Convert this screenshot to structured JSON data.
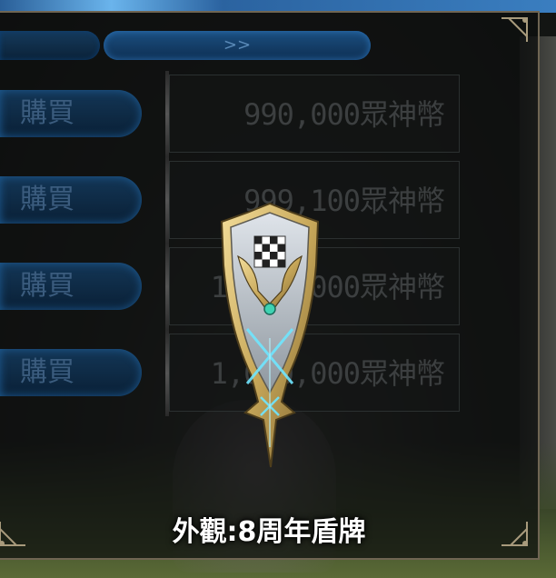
{
  "header": {
    "arrow_label": ">>"
  },
  "rows": [
    {
      "button_label": "購買",
      "price": "990,000眾神幣"
    },
    {
      "button_label": "購買",
      "price": "999,100眾神幣"
    },
    {
      "button_label": "購買",
      "price": "1,000,000眾神幣"
    },
    {
      "button_label": "購買",
      "price": "1,000,000眾神幣"
    }
  ],
  "item": {
    "caption": "外觀:8周年盾牌",
    "icon": "shield-icon"
  },
  "colors": {
    "accent_blue": "#1b4f80",
    "gold": "#c8a85a",
    "glow_cyan": "#6fe6ff"
  }
}
